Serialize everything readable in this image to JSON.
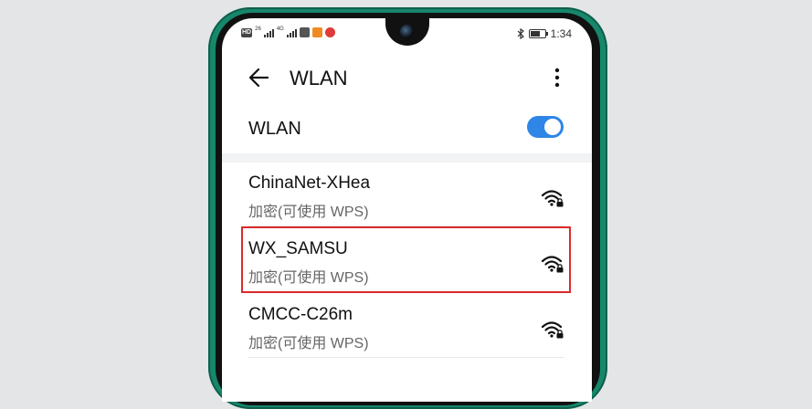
{
  "status_bar": {
    "hd": "HD",
    "net1": "26",
    "net2": "4G",
    "time": "1:34",
    "icons": [
      "hd-icon",
      "signal-icon",
      "signal-icon",
      "app-icon",
      "app-icon",
      "app-icon",
      "bluetooth-icon",
      "battery-icon"
    ]
  },
  "header": {
    "title": "WLAN",
    "back_icon": "arrow-left-icon",
    "menu_icon": "more-vertical-icon"
  },
  "wlan_toggle": {
    "label": "WLAN",
    "enabled": true,
    "accent": "#2f86e6"
  },
  "networks": [
    {
      "name": "ChinaNet-XHea",
      "status": "加密(可使用 WPS)",
      "icon": "wifi-lock-icon"
    },
    {
      "name": "WX_SAMSU",
      "status": "加密(可使用 WPS)",
      "icon": "wifi-lock-icon",
      "highlighted": true
    },
    {
      "name": "CMCC-C26m",
      "status": "加密(可使用 WPS)",
      "icon": "wifi-lock-icon"
    }
  ],
  "colors": {
    "highlight": "#d92b2b",
    "phone_frame": "#17876b"
  }
}
